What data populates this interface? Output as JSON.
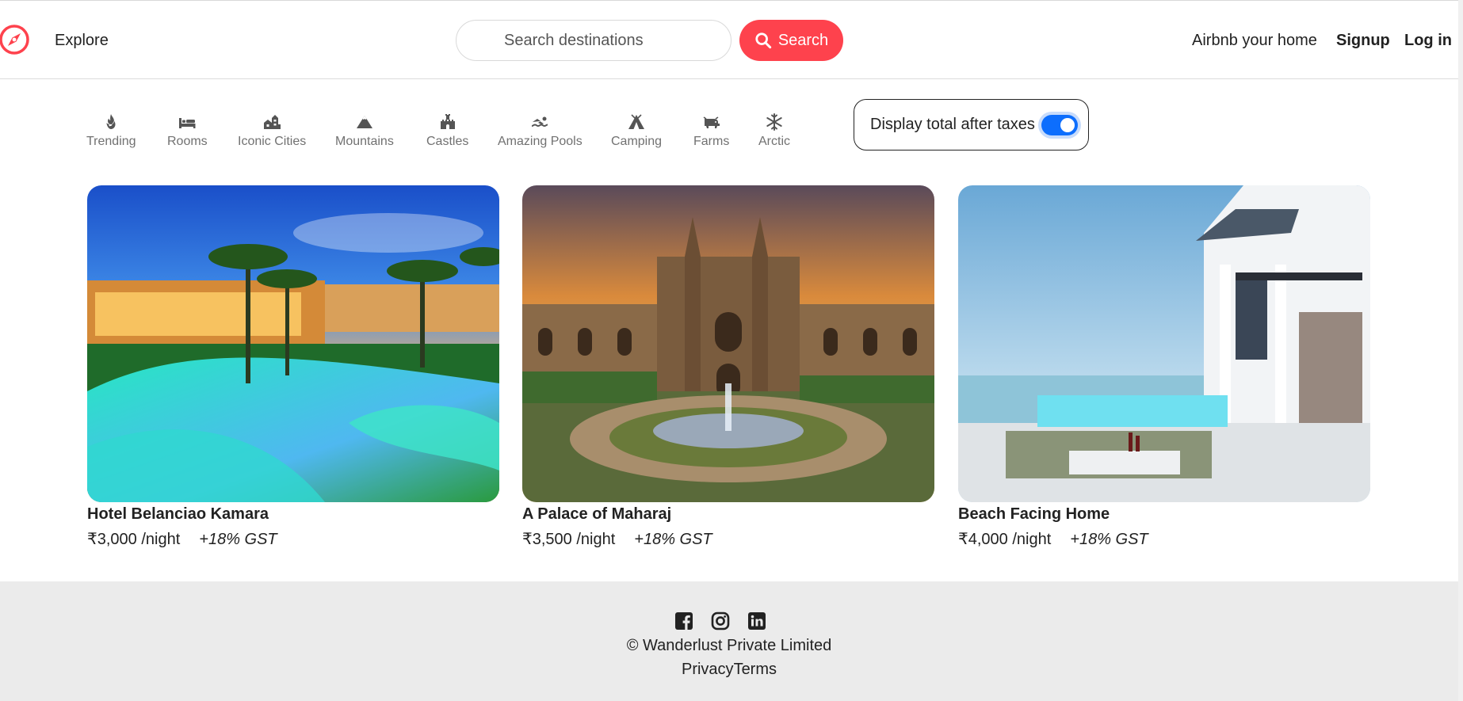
{
  "header": {
    "logo_icon": "compass-icon",
    "explore_label": "Explore",
    "search_placeholder": "Search destinations",
    "search_button_label": "Search",
    "host_link": "Airbnb your home",
    "signup_link": "Signup",
    "login_link": "Log in",
    "brand_color": "#fe424d"
  },
  "filters": [
    {
      "label": "Trending",
      "icon": "fire-icon"
    },
    {
      "label": "Rooms",
      "icon": "bed-icon"
    },
    {
      "label": "Iconic Cities",
      "icon": "city-icon"
    },
    {
      "label": "Mountains",
      "icon": "mountain-icon"
    },
    {
      "label": "Castles",
      "icon": "castle-icon"
    },
    {
      "label": "Amazing Pools",
      "icon": "swimmer-icon"
    },
    {
      "label": "Camping",
      "icon": "tent-icon"
    },
    {
      "label": "Farms",
      "icon": "cow-icon"
    },
    {
      "label": "Arctic",
      "icon": "snowflake-icon"
    }
  ],
  "tax_toggle": {
    "label": "Display total after taxes",
    "checked": true,
    "accent_color": "#0d6efd"
  },
  "listings": [
    {
      "title": "Hotel Belanciao Kamara",
      "price": "₹3,000 /night",
      "gst": "+18% GST",
      "image": "resort pool with palm trees at dusk"
    },
    {
      "title": "A Palace of Maharaj",
      "price": "₹3,500 /night",
      "gst": "+18% GST",
      "image": "gothic palace with fountain garden at sunset"
    },
    {
      "title": "Beach Facing Home",
      "price": "₹4,000 /night",
      "gst": "+18% GST",
      "image": "white beach house with infinity pool"
    }
  ],
  "footer": {
    "socials": [
      {
        "name": "facebook-icon"
      },
      {
        "name": "instagram-icon"
      },
      {
        "name": "linkedin-icon"
      }
    ],
    "copyright": "© Wanderlust Private Limited",
    "privacy_link": "Privacy",
    "terms_link": "Terms"
  }
}
